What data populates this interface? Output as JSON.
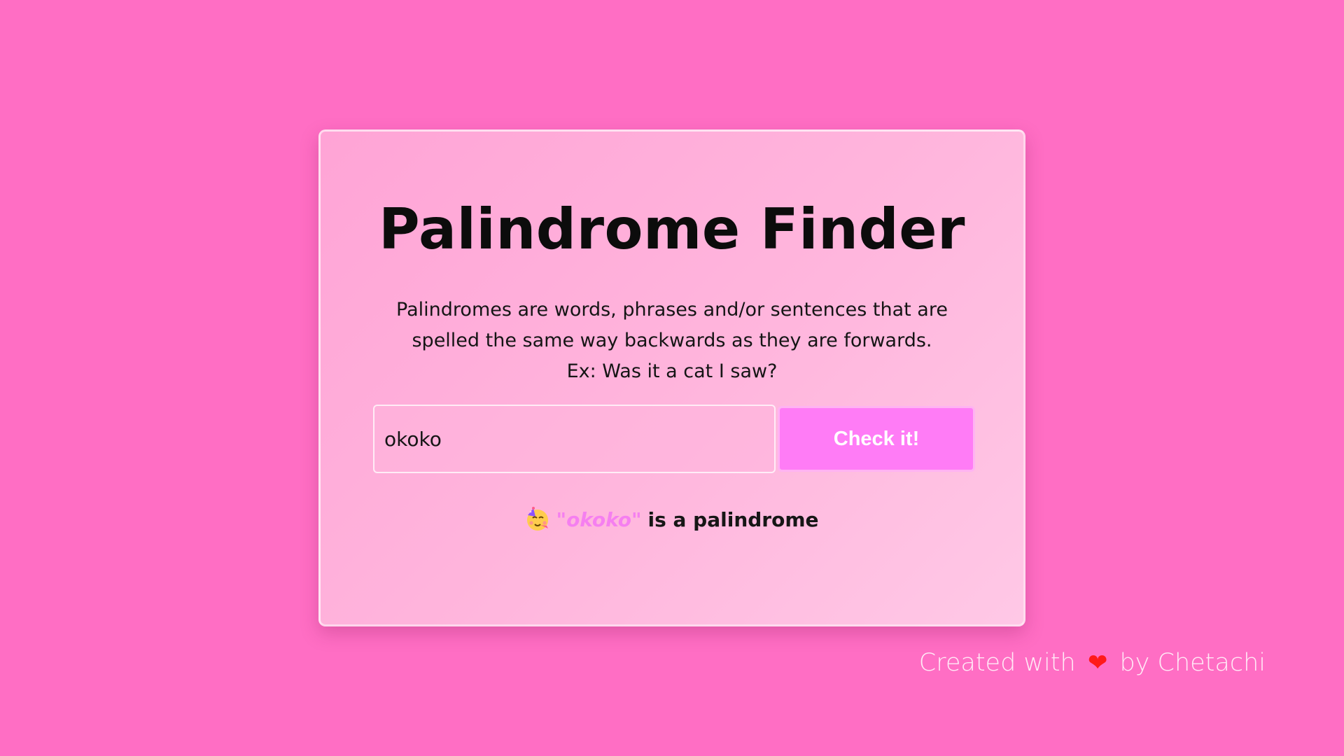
{
  "colors": {
    "page_background": "#ff6ec4",
    "button_background": "#ff7cf6",
    "highlight_word": "#f57ff0",
    "heart": "#ff1a1a"
  },
  "card": {
    "title": "Palindrome Finder",
    "description_lines": [
      "Palindromes are words, phrases and/or sentences that are",
      "spelled the same way backwards as they are forwards.",
      "Ex: Was it a cat I saw?"
    ],
    "input": {
      "value": "okoko",
      "placeholder": ""
    },
    "button_label": "Check it!",
    "result": {
      "emoji_icon": "partying-face-icon",
      "word_quoted": "\"okoko\"",
      "message": "is a palindrome"
    }
  },
  "footer": {
    "prefix": "Created with",
    "heart_icon": "heart-icon",
    "heart_glyph": "❤",
    "suffix": "by Chetachi"
  }
}
